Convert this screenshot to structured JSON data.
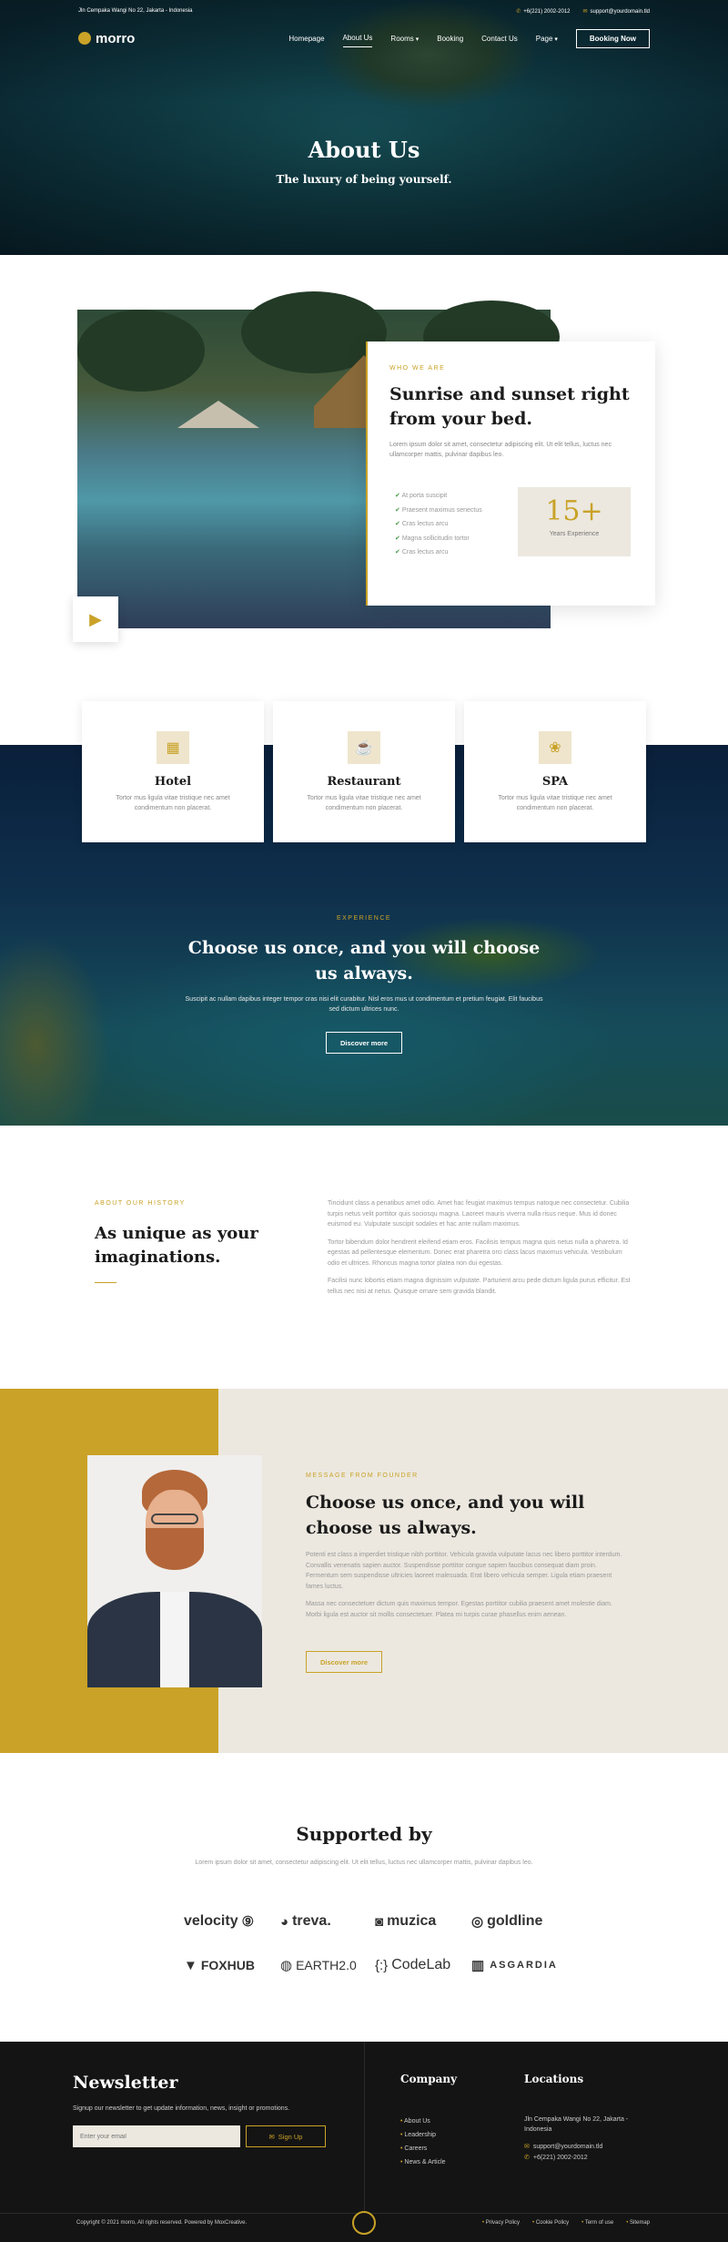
{
  "topbar": {
    "address": "Jln Cempaka Wangi No 22, Jakarta - Indonesia",
    "phone": "+6(221) 2002-2012",
    "email": "support@yourdomain.tld"
  },
  "nav": {
    "logo": "morro",
    "items": [
      "Homepage",
      "About Us",
      "Rooms",
      "Booking",
      "Contact Us",
      "Page"
    ],
    "cta": "Booking Now"
  },
  "hero": {
    "title": "About Us",
    "subtitle": "The luxury of being yourself."
  },
  "about": {
    "eyebrow": "WHO WE ARE",
    "title": "Sunrise and sunset right from your bed.",
    "text": "Lorem ipsum dolor sit amet, consectetur adipiscing elit. Ut elit tellus, luctus nec ullamcorper mattis, pulvinar dapibus leo.",
    "checklist": [
      "At porta suscipit",
      "Praesent maximus senectus",
      "Cras lectus arcu",
      "Magna sollicitudin tortor",
      "Cras lectus arcu"
    ],
    "experience_number": "15+",
    "experience_label": "Years Experience"
  },
  "features": [
    {
      "icon": "hotel-icon",
      "title": "Hotel",
      "text": "Tortor mus ligula vitae tristique nec amet condimentum non placerat."
    },
    {
      "icon": "restaurant-icon",
      "title": "Restaurant",
      "text": "Tortor mus ligula vitae tristique nec amet condimentum non placerat."
    },
    {
      "icon": "spa-icon",
      "title": "SPA",
      "text": "Tortor mus ligula vitae tristique nec amet condimentum non placerat."
    }
  ],
  "experience": {
    "eyebrow": "EXPERIENCE",
    "title": "Choose us once, and you will choose us always.",
    "text": "Suscipit ac nullam dapibus integer tempor cras nisi elit curabitur. Nisl eros mus ut condimentum et pretium feugiat. Elit faucibus sed dictum ultrices nunc.",
    "button": "Discover more"
  },
  "history": {
    "eyebrow": "ABOUT OUR HISTORY",
    "title": "As unique as your imaginations.",
    "paragraphs": [
      "Tincidunt class a penatibus amet odio. Amet hac feugiat maximus tempus natoque nec consectetur. Cubilia turpis netus velit porttitor quis sociosqu magna. Laoreet mauris viverra nulla risus neque. Mus id donec euismod eu. Vulputate suscipit sodales et hac ante nullam maximus.",
      "Tortor bibendum dolor hendrerit eleifend etiam eros. Facilisis tempus magna quis netus nulla a pharetra. Id egestas ad pellentesque elementum. Donec erat pharetra orci class lacus maximus vehicula. Vestibulum odio et ultrices. Rhoncus magna tortor platea non dui egestas.",
      "Facilisi nunc lobortis etiam magna dignissim vulputate. Parturient arcu pede dictum ligula purus efficitur. Est tellus nec nisi at netus. Quisque ornare sem gravida blandit."
    ]
  },
  "founder": {
    "eyebrow": "MESSAGE FROM FOUNDER",
    "title": "Choose us once, and you will choose us always.",
    "paragraphs": [
      "Potenti est class a imperdiet tristique nibh porttitor. Vehicula gravida vulputate lacus nec libero porttitor interdum. Convallis venenatis sapien auctor. Suspendisse porttitor congue sapien faucibus consequat diam proin. Fermentum sem suspendisse ultricies laoreet malesuada. Erat libero vehicula semper. Ligula etiam praesent fames luctus.",
      "Massa nec consectetuer dictum quis maximus tempor. Egestas porttitor cubilia praesent amet molestie diam. Morbi ligula est auctor sit mollis consectetuer. Platea mi turpis curae phasellus enim aenean."
    ],
    "button": "Discover more"
  },
  "supported": {
    "title": "Supported by",
    "text": "Lorem ipsum dolor sit amet, consectetur adipiscing elit. Ut elit tellus, luctus nec ullamcorper mattis, pulvinar dapibus leo.",
    "brands": [
      "velocity",
      "treva.",
      "muzica",
      "goldline",
      "FOXHUB",
      "EARTH2.0",
      "CodeLab",
      "ASGARDIA"
    ]
  },
  "newsletter": {
    "title": "Newsletter",
    "text": "Signup our newsletter to get update information, news, insight or promotions.",
    "placeholder": "Enter your email",
    "button": "Sign Up"
  },
  "company": {
    "title": "Company",
    "links": [
      "About Us",
      "Leadership",
      "Careers",
      "News & Article"
    ]
  },
  "locations": {
    "title": "Locations",
    "address": "Jln Cempaka Wangi No 22, Jakarta - Indonesia",
    "email": "support@yourdomain.tld",
    "phone": "+6(221) 2002-2012"
  },
  "legal": {
    "copyright": "Copyright © 2021 morro, All rights reserved. Powered by MoxCreative.",
    "links": [
      "Privacy Policy",
      "Cookie Policy",
      "Term of use",
      "Sitemap"
    ]
  }
}
